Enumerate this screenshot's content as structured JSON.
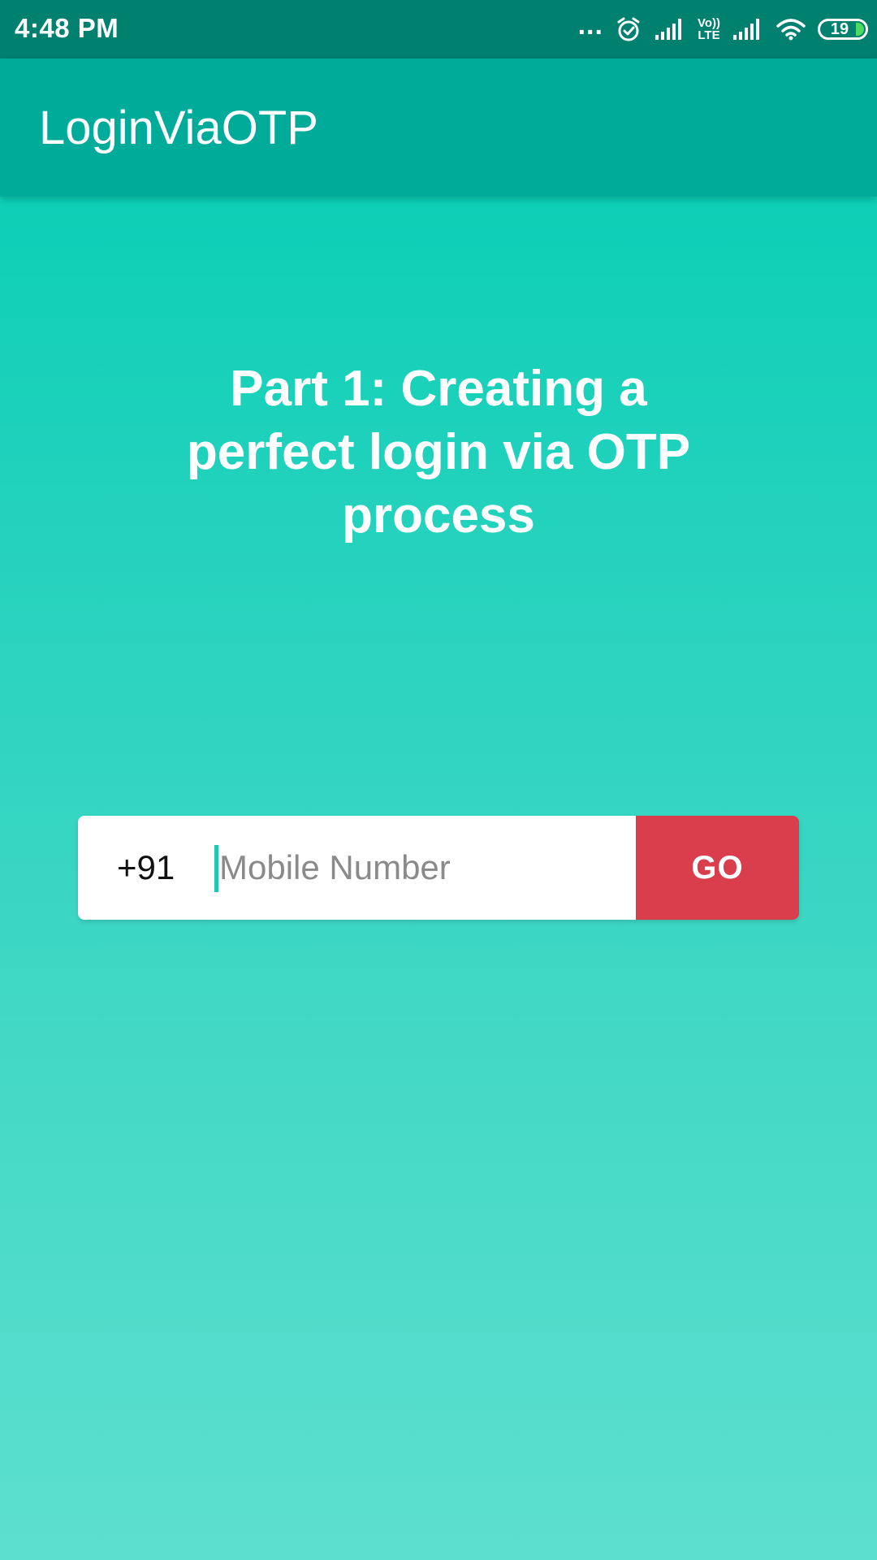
{
  "status_bar": {
    "time": "4:48 PM",
    "dots": "...",
    "volte_top": "Vo))",
    "volte_bottom": "LTE",
    "battery_level": "19",
    "icons": [
      "more-icon",
      "alarm-icon",
      "signal-icon",
      "volte-icon",
      "signal-icon",
      "wifi-icon",
      "battery-icon"
    ]
  },
  "app_bar": {
    "title": "LoginViaOTP"
  },
  "main": {
    "headline": "Part 1: Creating a perfect login via OTP process",
    "country_code": "+91",
    "mobile_placeholder": "Mobile Number",
    "mobile_value": "",
    "go_label": "GO"
  },
  "colors": {
    "status_bar": "#00806f",
    "app_bar": "#00ab9a",
    "background_top": "#00cdb3",
    "background_bottom": "#5ddfcf",
    "go_button": "#da3e4c",
    "cursor": "#1ec8b4",
    "battery_fill": "#4cd964"
  }
}
